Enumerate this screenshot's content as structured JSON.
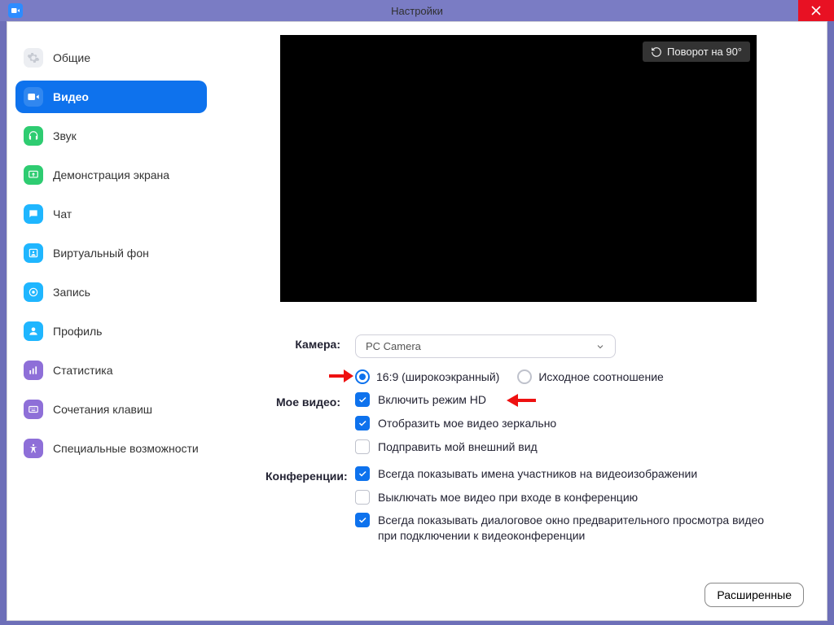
{
  "window": {
    "title": "Настройки"
  },
  "sidebar": {
    "items": [
      {
        "label": "Общие"
      },
      {
        "label": "Видео"
      },
      {
        "label": "Звук"
      },
      {
        "label": "Демонстрация экрана"
      },
      {
        "label": "Чат"
      },
      {
        "label": "Виртуальный фон"
      },
      {
        "label": "Запись"
      },
      {
        "label": "Профиль"
      },
      {
        "label": "Статистика"
      },
      {
        "label": "Сочетания клавиш"
      },
      {
        "label": "Специальные возможности"
      }
    ]
  },
  "preview": {
    "rotate_label": "Поворот на 90°"
  },
  "camera": {
    "label": "Камера:",
    "selected": "PC Camera",
    "ratio_wide": "16:9 (широкоэкранный)",
    "ratio_original": "Исходное соотношение"
  },
  "my_video": {
    "label": "Мое видео:",
    "hd": "Включить режим HD",
    "mirror": "Отобразить мое видео зеркально",
    "touchup": "Подправить мой внешний вид"
  },
  "meetings": {
    "label": "Конференции:",
    "names": "Всегда показывать имена участников на видеоизображении",
    "off_join": "Выключать мое видео при входе в конференцию",
    "preview": "Всегда показывать диалоговое окно предварительного просмотра видео при подключении к видеоконференции"
  },
  "footer": {
    "advanced": "Расширенные"
  }
}
